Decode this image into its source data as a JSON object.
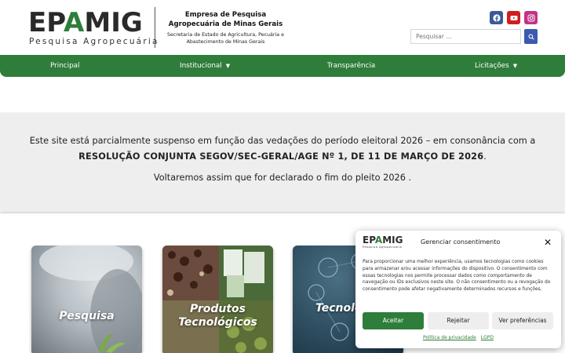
{
  "header": {
    "logo_text_left": "EP",
    "logo_text_accent": "A",
    "logo_text_right": "MIG",
    "logo_subtitle": "Pesquisa Agropecuária",
    "org_title": "Empresa de Pesquisa Agropecuária de Minas Gerais",
    "org_subtitle": "Secretaria de Estado de Agricultura, Pecuária e Abastecimento de Minas Gerais",
    "social": [
      {
        "name": "facebook-icon",
        "color": "#3b5998"
      },
      {
        "name": "youtube-icon",
        "color": "#cd201f"
      },
      {
        "name": "instagram-icon",
        "color": "#c13584"
      }
    ],
    "search_placeholder": "Pesquisar ...",
    "search_icon": "search-icon"
  },
  "nav": {
    "items": [
      {
        "label": "Principal",
        "has_dropdown": false
      },
      {
        "label": "Institucional",
        "has_dropdown": true
      },
      {
        "label": "Transparência",
        "has_dropdown": false
      },
      {
        "label": "Licitações",
        "has_dropdown": true
      }
    ],
    "color": "#2f7d3a"
  },
  "notice": {
    "line1": "Este site está parcialmente suspenso em função das vedações do período eleitoral 2026 – em consonância com a",
    "line2_bold": "RESOLUÇÃO CONJUNTA SEGOV/SEC-GERAL/AGE Nº 1, DE 11 DE MARÇO DE 2026",
    "line2_end": ".",
    "line3": "Voltaremos assim que for declarado o fim do pleito 2026 ."
  },
  "cards": [
    {
      "label": "Pesquisa"
    },
    {
      "label_line1": "Produtos",
      "label_line2": "Tecnológicos"
    },
    {
      "label": "Tecnolo"
    }
  ],
  "consent": {
    "logo_text_left": "EP",
    "logo_text_accent": "A",
    "logo_text_right": "MIG",
    "logo_subtitle": "Pesquisa Agropecuária",
    "title": "Gerenciar consentimento",
    "body": "Para proporcionar uma melhor experiência, usamos tecnologias como cookies para armazenar e/ou acessar informações do dispositivo. O consentimento com essas tecnologias nos permite processar dados como comportamento de navegação ou IDs exclusivos neste site. O não consentimento ou a revogação do consentimento pode afetar negativamente determinados recursos e funções.",
    "accept_label": "Aceitar",
    "reject_label": "Rejeitar",
    "prefs_label": "Ver preferências",
    "link_privacy": "Política de privacidade",
    "link_lgpd": "LGPD"
  }
}
